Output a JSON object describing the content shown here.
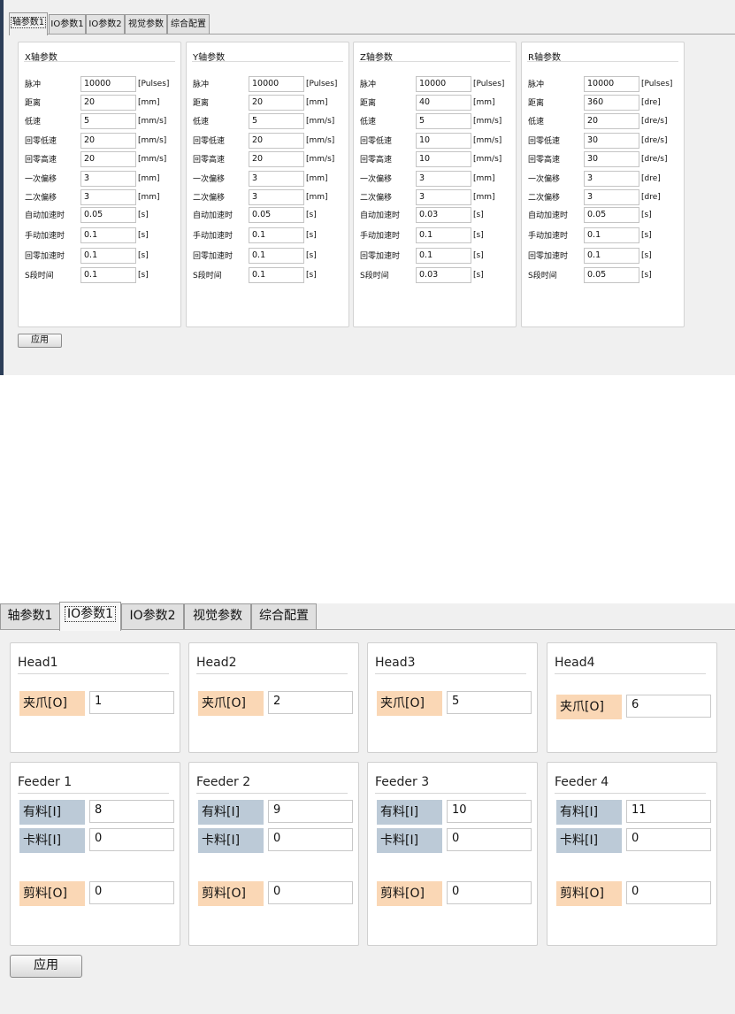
{
  "top": {
    "tabs": [
      "轴参数1",
      "IO参数1",
      "IO参数2",
      "视觉参数",
      "综合配置"
    ],
    "active_tab": 0,
    "apply_label": "应用",
    "groups": [
      {
        "title": "X轴参数",
        "rows": [
          {
            "label": "脉冲",
            "value": "10000",
            "unit": "[Pulses]"
          },
          {
            "label": "距离",
            "value": "20",
            "unit": "[mm]"
          },
          {
            "label": "低速",
            "value": "5",
            "unit": "[mm/s]"
          },
          {
            "label": "回零低速",
            "value": "20",
            "unit": "[mm/s]"
          },
          {
            "label": "回零高速",
            "value": "20",
            "unit": "[mm/s]"
          },
          {
            "label": "一次偏移",
            "value": "3",
            "unit": "[mm]"
          },
          {
            "label": "二次偏移",
            "value": "3",
            "unit": "[mm]"
          },
          {
            "label": "自动加速时",
            "value": "0.05",
            "unit": "[s]"
          },
          {
            "label": "手动加速时",
            "value": "0.1",
            "unit": "[s]"
          },
          {
            "label": "回零加速时",
            "value": "0.1",
            "unit": "[s]"
          },
          {
            "label": "S段时间",
            "value": "0.1",
            "unit": "[s]"
          }
        ]
      },
      {
        "title": "Y轴参数",
        "rows": [
          {
            "label": "脉冲",
            "value": "10000",
            "unit": "[Pulses]"
          },
          {
            "label": "距离",
            "value": "20",
            "unit": "[mm]"
          },
          {
            "label": "低速",
            "value": "5",
            "unit": "[mm/s]"
          },
          {
            "label": "回零低速",
            "value": "20",
            "unit": "[mm/s]"
          },
          {
            "label": "回零高速",
            "value": "20",
            "unit": "[mm/s]"
          },
          {
            "label": "一次偏移",
            "value": "3",
            "unit": "[mm]"
          },
          {
            "label": "二次偏移",
            "value": "3",
            "unit": "[mm]"
          },
          {
            "label": "自动加速时",
            "value": "0.05",
            "unit": "[s]"
          },
          {
            "label": "手动加速时",
            "value": "0.1",
            "unit": "[s]"
          },
          {
            "label": "回零加速时",
            "value": "0.1",
            "unit": "[s]"
          },
          {
            "label": "S段时间",
            "value": "0.1",
            "unit": "[s]"
          }
        ]
      },
      {
        "title": "Z轴参数",
        "rows": [
          {
            "label": "脉冲",
            "value": "10000",
            "unit": "[Pulses]"
          },
          {
            "label": "距离",
            "value": "40",
            "unit": "[mm]"
          },
          {
            "label": "低速",
            "value": "5",
            "unit": "[mm/s]"
          },
          {
            "label": "回零低速",
            "value": "10",
            "unit": "[mm/s]"
          },
          {
            "label": "回零高速",
            "value": "10",
            "unit": "[mm/s]"
          },
          {
            "label": "一次偏移",
            "value": "3",
            "unit": "[mm]"
          },
          {
            "label": "二次偏移",
            "value": "3",
            "unit": "[mm]"
          },
          {
            "label": "自动加速时",
            "value": "0.03",
            "unit": "[s]"
          },
          {
            "label": "手动加速时",
            "value": "0.1",
            "unit": "[s]"
          },
          {
            "label": "回零加速时",
            "value": "0.1",
            "unit": "[s]"
          },
          {
            "label": "S段时间",
            "value": "0.03",
            "unit": "[s]"
          }
        ]
      },
      {
        "title": "R轴参数",
        "rows": [
          {
            "label": "脉冲",
            "value": "10000",
            "unit": "[Pulses]"
          },
          {
            "label": "距离",
            "value": "360",
            "unit": "[dre]"
          },
          {
            "label": "低速",
            "value": "20",
            "unit": "[dre/s]"
          },
          {
            "label": "回零低速",
            "value": "30",
            "unit": "[dre/s]"
          },
          {
            "label": "回零高速",
            "value": "30",
            "unit": "[dre/s]"
          },
          {
            "label": "一次偏移",
            "value": "3",
            "unit": "[dre]"
          },
          {
            "label": "二次偏移",
            "value": "3",
            "unit": "[dre]"
          },
          {
            "label": "自动加速时",
            "value": "0.05",
            "unit": "[s]"
          },
          {
            "label": "手动加速时",
            "value": "0.1",
            "unit": "[s]"
          },
          {
            "label": "回零加速时",
            "value": "0.1",
            "unit": "[s]"
          },
          {
            "label": "S段时间",
            "value": "0.05",
            "unit": "[s]"
          }
        ]
      }
    ]
  },
  "bottom": {
    "tabs": [
      "轴参数1",
      "IO参数1",
      "IO参数2",
      "视觉参数",
      "综合配置"
    ],
    "active_tab": 1,
    "apply_label": "应用",
    "heads": [
      {
        "title": "Head1",
        "fields": [
          {
            "label": "夹爪[O]",
            "value": "1",
            "type": "output"
          }
        ]
      },
      {
        "title": "Head2",
        "fields": [
          {
            "label": "夹爪[O]",
            "value": "2",
            "type": "output"
          }
        ]
      },
      {
        "title": "Head3",
        "fields": [
          {
            "label": "夹爪[O]",
            "value": "5",
            "type": "output"
          }
        ]
      },
      {
        "title": "Head4",
        "fields": [
          {
            "label": "夹爪[O]",
            "value": "6",
            "type": "output"
          }
        ]
      }
    ],
    "feeders": [
      {
        "title": "Feeder 1",
        "fields": [
          {
            "label": "有料[I]",
            "value": "8",
            "type": "input"
          },
          {
            "label": "卡料[I]",
            "value": "0",
            "type": "input"
          },
          {
            "label": "剪料[O]",
            "value": "0",
            "type": "output"
          }
        ]
      },
      {
        "title": "Feeder 2",
        "fields": [
          {
            "label": "有料[I]",
            "value": "9",
            "type": "input"
          },
          {
            "label": "卡料[I]",
            "value": "0",
            "type": "input"
          },
          {
            "label": "剪料[O]",
            "value": "0",
            "type": "output"
          }
        ]
      },
      {
        "title": "Feeder 3",
        "fields": [
          {
            "label": "有料[I]",
            "value": "10",
            "type": "input"
          },
          {
            "label": "卡料[I]",
            "value": "0",
            "type": "input"
          },
          {
            "label": "剪料[O]",
            "value": "0",
            "type": "output"
          }
        ]
      },
      {
        "title": "Feeder 4",
        "fields": [
          {
            "label": "有料[I]",
            "value": "11",
            "type": "input"
          },
          {
            "label": "卡料[I]",
            "value": "0",
            "type": "input"
          },
          {
            "label": "剪料[O]",
            "value": "0",
            "type": "output"
          }
        ]
      }
    ],
    "colors": {
      "output_label": "#fad7b5",
      "input_label": "#bccad7"
    }
  }
}
